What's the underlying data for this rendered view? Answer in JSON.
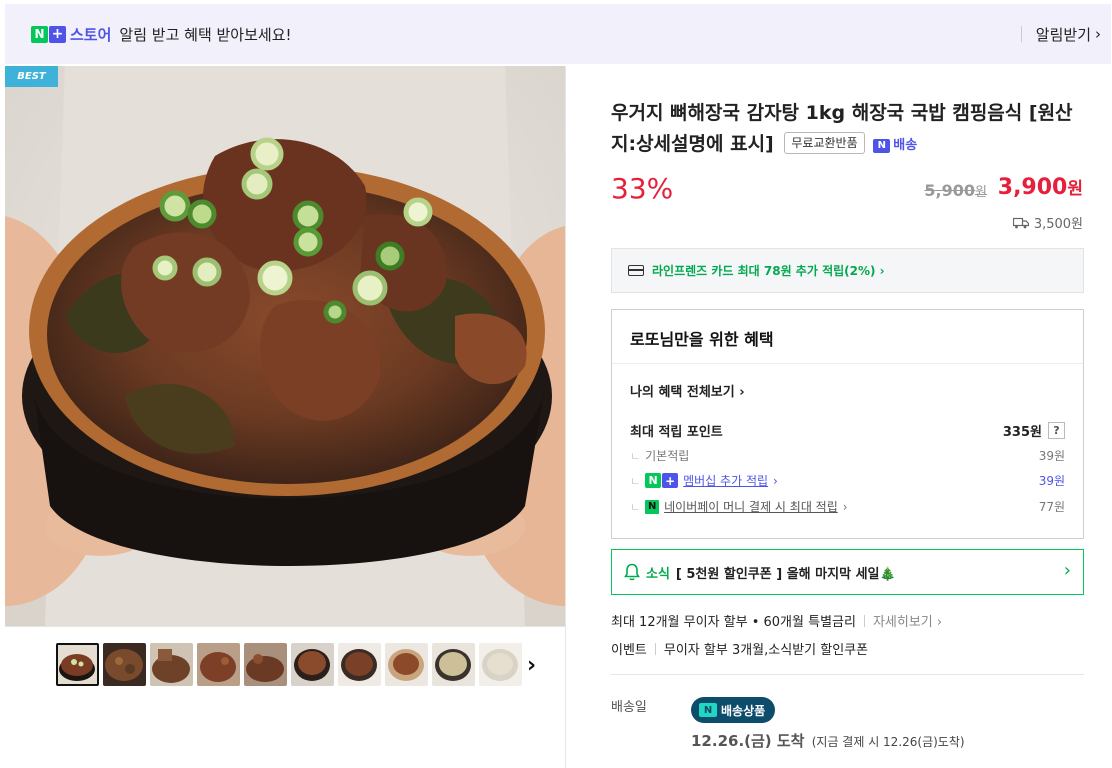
{
  "topbar": {
    "store_prefix_n": "N",
    "store_prefix_plus": "+",
    "store_word": "스토어",
    "message": "알림 받고 혜택 받아보세요!",
    "subscribe_label": "알림받기"
  },
  "product": {
    "best_badge": "BEST",
    "title": "우거지 뼈해장국 감자탕 1kg 해장국 국밥 캠핑음식 [원산지:상세설명에 표시]",
    "exchange_badge": "무료교환반품",
    "delivery_badge": "배송",
    "discount": "33%",
    "original_price": "5,900",
    "original_price_unit": "원",
    "sale_price": "3,900",
    "sale_price_unit": "원",
    "shipping_fee": "3,500원"
  },
  "card_benefit": "라인프렌즈 카드 최대 78원 추가 적립(2%) ›",
  "benefit": {
    "title": "로또님만을 위한 혜택",
    "view_all": "나의 혜택 전체보기 ›",
    "max_points_label": "최대 적립 포인트",
    "max_points_value": "335원",
    "help": "?",
    "basic_label": "기본적립",
    "basic_value": "39원",
    "membership_label": "멤버십 추가 적립",
    "membership_value": "39원",
    "npay_label": "네이버페이 머니 결제 시 최대 적립",
    "npay_value": "77원",
    "tick": "ㄴ"
  },
  "notice": {
    "label": "소식",
    "body": "[ 5천원 할인쿠폰 ] 올해 마지막 세일🎄",
    "arrow": "›"
  },
  "installment": {
    "text": "최대 12개월 무이자 할부 • 60개월 특별금리",
    "detail": "자세히보기 ›"
  },
  "event": {
    "label": "이벤트",
    "text": "무이자 할부 3개월,소식받기 할인쿠폰"
  },
  "shipping": {
    "label": "배송일",
    "pill": "배송상품",
    "arrive_date": "12.26.(금) 도착",
    "arrive_note": "(지금 결제 시 12.26(금)도착)"
  },
  "thumbs_next": "›",
  "colors": {
    "naver_green": "#03c75a",
    "store_purple": "#4f54e8",
    "sale_red": "#e6203a",
    "pill_navy": "#0d4c6b"
  }
}
